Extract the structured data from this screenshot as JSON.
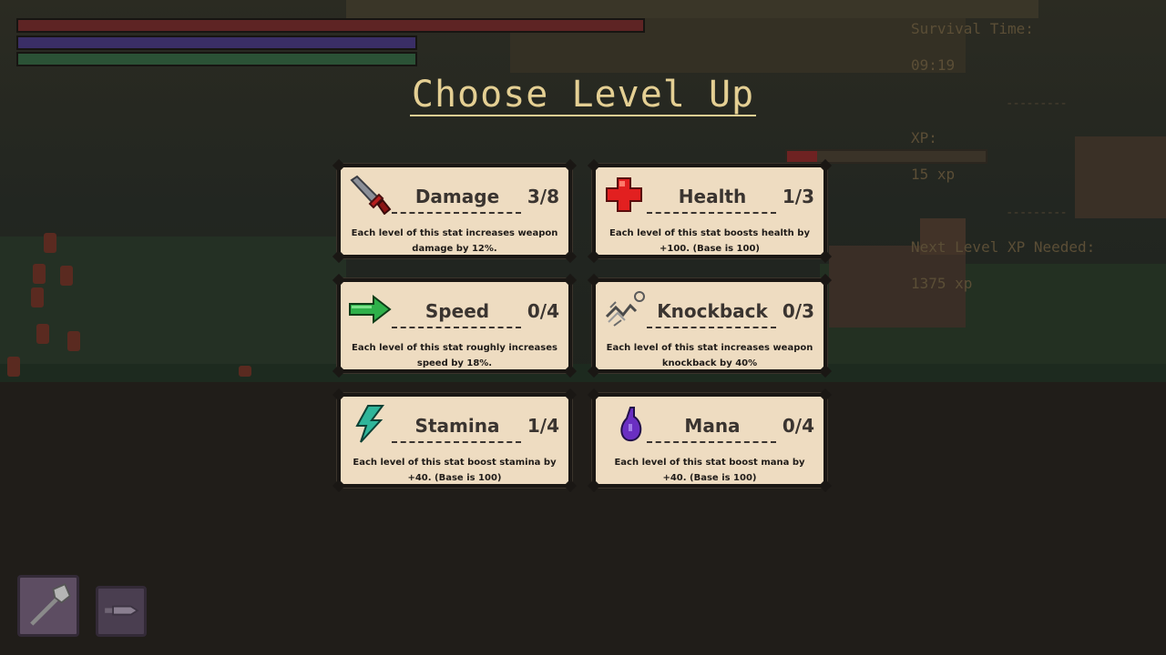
{
  "hud": {
    "health_fill": 1.0,
    "mana_fill": 1.0,
    "stamina_fill": 1.0
  },
  "stats": {
    "survival_label": "Survival Time:",
    "survival_value": "09:19",
    "separator": "---------",
    "xp_label": "XP:",
    "xp_value": "15 xp",
    "xp_progress": 0.15,
    "next_label": "Next Level XP Needed:",
    "next_value": "1375 xp"
  },
  "title": "Choose Level Up",
  "cards": [
    {
      "name": "Damage",
      "level": "3/8",
      "icon": "sword-icon",
      "desc": "Each level of this stat increases weapon damage by 12%."
    },
    {
      "name": "Health",
      "level": "1/3",
      "icon": "red-cross-icon",
      "desc": "Each level of this stat boosts health by +100. (Base is 100)"
    },
    {
      "name": "Speed",
      "level": "0/4",
      "icon": "green-arrow-icon",
      "desc": "Each level of this stat roughly increases speed by 18%."
    },
    {
      "name": "Knockback",
      "level": "0/3",
      "icon": "knockback-icon",
      "desc": "Each level of this stat increases weapon knockback by 40%"
    },
    {
      "name": "Stamina",
      "level": "1/4",
      "icon": "stamina-bolt-icon",
      "desc": "Each level of this stat boost stamina by +40. (Base is 100)"
    },
    {
      "name": "Mana",
      "level": "0/4",
      "icon": "mana-potion-icon",
      "desc": "Each level of this stat boost mana by +40. (Base is 100)"
    }
  ],
  "hotbar": [
    {
      "icon": "axe-icon"
    },
    {
      "icon": "dagger-icon"
    }
  ],
  "colors": {
    "title": "#e4cf93",
    "card_bg": "#eedcc1",
    "health_bar": "#5e2424",
    "mana_bar": "#3a2e66",
    "stamina_bar": "#2b5236",
    "xp_bar": "#6e2222"
  }
}
